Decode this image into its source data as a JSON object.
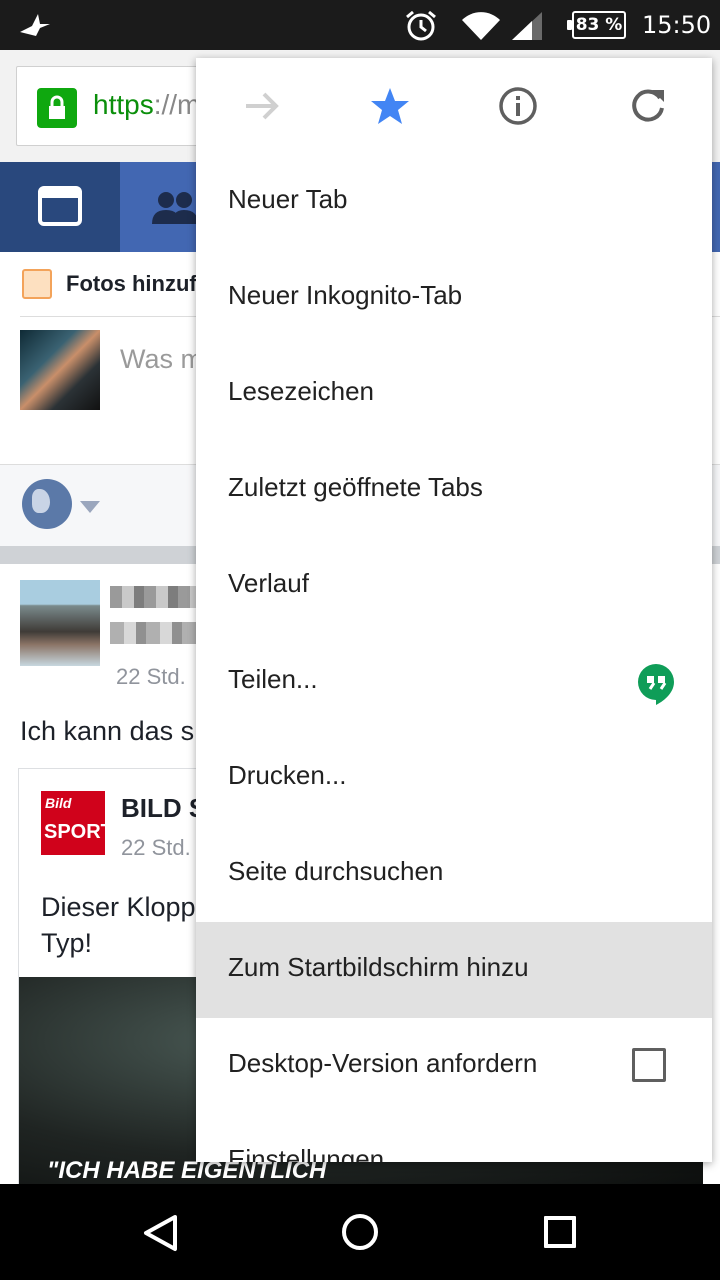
{
  "status_bar": {
    "battery": "83 %",
    "time": "15:50"
  },
  "browser": {
    "url_scheme": "https",
    "url_rest": "://m"
  },
  "composer": {
    "add_photos": "Fotos hinzuf",
    "placeholder": "Was m"
  },
  "post": {
    "time": "22 Std.",
    "text": "Ich kann das s",
    "card": {
      "logo_top": "Bild",
      "logo_bottom": "SPORT",
      "title": "BILD S",
      "time": "22 Std.",
      "text": "Dieser Klopp\nTyp!",
      "image_quote": "\"ICH HABE EIGENTLICH"
    }
  },
  "menu": {
    "items": [
      {
        "label": "Neuer Tab"
      },
      {
        "label": "Neuer Inkognito-Tab"
      },
      {
        "label": "Lesezeichen"
      },
      {
        "label": "Zuletzt geöffnete Tabs"
      },
      {
        "label": "Verlauf"
      },
      {
        "label": "Teilen..."
      },
      {
        "label": "Drucken..."
      },
      {
        "label": "Seite durchsuchen"
      },
      {
        "label": "Zum Startbildschirm hinzu"
      },
      {
        "label": "Desktop-Version anfordern"
      },
      {
        "label": "Einstellungen"
      }
    ],
    "highlighted_index": 8,
    "desktop_checked": false
  },
  "colors": {
    "facebook_blue": "#4267b2",
    "star_blue": "#4285f4",
    "https_green": "#0b8f0b",
    "hangouts_green": "#0f9d58"
  }
}
